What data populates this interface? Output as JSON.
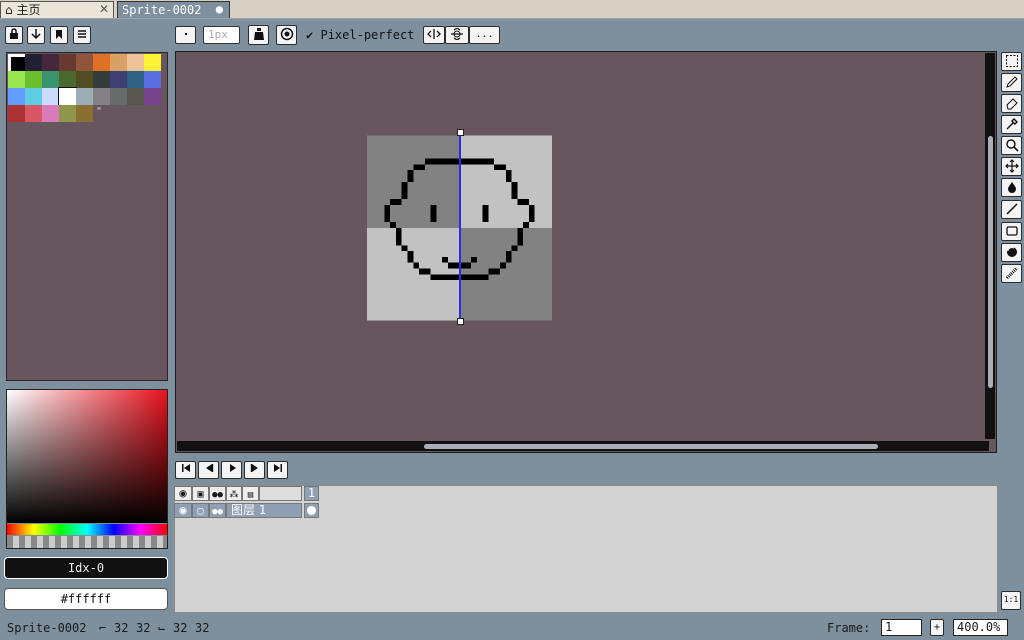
{
  "tabs": [
    {
      "label": "主页",
      "close_glyph": "✕",
      "icon": "home-icon"
    },
    {
      "label": "Sprite-0002",
      "modified_glyph": "●"
    }
  ],
  "toolbar": {
    "brush_size": "1px",
    "pixel_perfect_check": "✔",
    "pixel_perfect_label": "Pixel-perfect",
    "more_label": "..."
  },
  "palette": {
    "colors": [
      "#000000",
      "#222034",
      "#45283c",
      "#663931",
      "#8f563b",
      "#df7126",
      "#d9a066",
      "#eec39a",
      "#fbf236",
      "#99e550",
      "#6abe30",
      "#37946e",
      "#4b692f",
      "#524b24",
      "#323c39",
      "#3f3f74",
      "#306082",
      "#5b6ee1",
      "#639bff",
      "#5fcde4",
      "#cbdbfc",
      "#ffffff",
      "#9badb7",
      "#847e87",
      "#696a6a",
      "#595652",
      "#76428a",
      "#ac3232",
      "#d95763",
      "#d77bba",
      "#8f974a",
      "#8a6f30"
    ],
    "more_glyph": "\""
  },
  "color": {
    "index_label": "Idx-0",
    "hex_label": "#ffffff"
  },
  "timeline": {
    "frame_number": "1",
    "layer_name": "图层 1"
  },
  "status": {
    "sprite_name": "Sprite-0002",
    "size_w": "32",
    "size_h": "32",
    "cel_w": "32",
    "cel_h": "32",
    "frame_label": "Frame:",
    "frame_value": "1",
    "add_frame_glyph": "+",
    "zoom_value": "400.0%",
    "actual_size_label": "1:1"
  },
  "colors": {
    "workspace": "#7e8f9d",
    "canvas_bg": "#68565f",
    "symmetry_line": "#2233dd"
  }
}
